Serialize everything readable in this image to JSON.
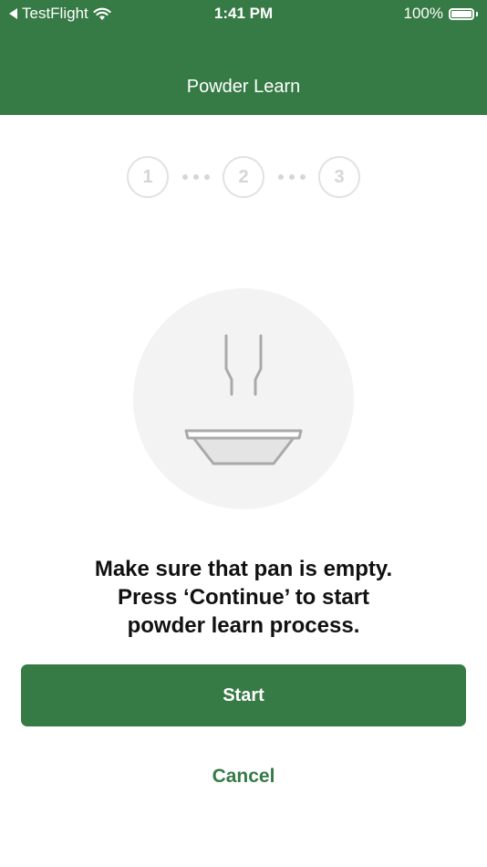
{
  "status_bar": {
    "back_app": "TestFlight",
    "time": "1:41 PM",
    "battery_percent": "100%",
    "battery_level": 1.0,
    "icons": [
      "back-arrow-icon",
      "wifi-icon",
      "battery-icon"
    ]
  },
  "nav": {
    "title": "Powder Learn"
  },
  "stepper": {
    "steps": [
      "1",
      "2",
      "3"
    ],
    "current_step": 0
  },
  "illustration": {
    "icon": "empty-pan-icon"
  },
  "message": {
    "line1": "Make sure that pan is empty.",
    "line2": "Press ‘Continue’ to start",
    "line3": "powder learn process."
  },
  "actions": {
    "start_label": "Start",
    "cancel_label": "Cancel"
  },
  "colors": {
    "brand": "#367a45",
    "step_inactive": "#d6d6d6",
    "illustration_bg": "#f3f3f3"
  }
}
